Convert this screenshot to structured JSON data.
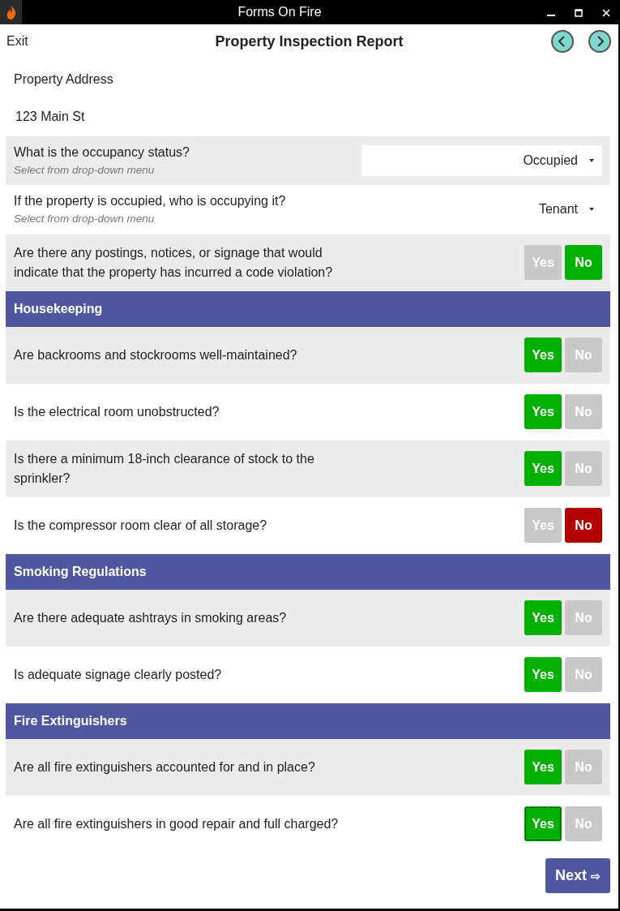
{
  "window": {
    "title": "Forms On Fire"
  },
  "header": {
    "exit": "Exit",
    "title": "Property Inspection Report"
  },
  "address": {
    "label": "Property Address",
    "value": "123 Main St"
  },
  "rows": [
    {
      "kind": "dropdown",
      "question": "What is the occupancy status?",
      "hint": "Select from drop-down menu",
      "value": "Occupied",
      "boxed": true
    },
    {
      "kind": "dropdown",
      "question": "If the property is occupied, who is occupying it?",
      "hint": "Select from drop-down menu",
      "value": "Tenant",
      "boxed": false
    },
    {
      "kind": "yesno",
      "question": "Are there any postings, notices, or signage that would indicate that the property has incurred a code violation?",
      "focused": false,
      "options": [
        {
          "label": "Yes",
          "selected": false,
          "color": "#c8c8c8"
        },
        {
          "label": "No",
          "selected": true,
          "color": "#00b000"
        }
      ]
    },
    {
      "kind": "section",
      "title": "Housekeeping"
    },
    {
      "kind": "yesno",
      "question": "Are backrooms and stockrooms well-maintained?",
      "focused": false,
      "options": [
        {
          "label": "Yes",
          "selected": true,
          "color": "#00b000"
        },
        {
          "label": "No",
          "selected": false,
          "color": "#c8c8c8"
        }
      ]
    },
    {
      "kind": "yesno",
      "question": "Is the electrical room unobstructed?",
      "focused": false,
      "options": [
        {
          "label": "Yes",
          "selected": true,
          "color": "#00b000"
        },
        {
          "label": "No",
          "selected": false,
          "color": "#c8c8c8"
        }
      ]
    },
    {
      "kind": "yesno",
      "question": "Is there a minimum 18-inch clearance of stock to the sprinkler?",
      "focused": false,
      "options": [
        {
          "label": "Yes",
          "selected": true,
          "color": "#00b000"
        },
        {
          "label": "No",
          "selected": false,
          "color": "#c8c8c8"
        }
      ]
    },
    {
      "kind": "yesno",
      "question": "Is the compressor room clear of all storage?",
      "focused": false,
      "options": [
        {
          "label": "Yes",
          "selected": false,
          "color": "#c8c8c8"
        },
        {
          "label": "No",
          "selected": true,
          "color": "#b20000"
        }
      ]
    },
    {
      "kind": "section",
      "title": "Smoking Regulations"
    },
    {
      "kind": "yesno",
      "question": "Are there adequate ashtrays in smoking areas?",
      "focused": false,
      "options": [
        {
          "label": "Yes",
          "selected": true,
          "color": "#00b000"
        },
        {
          "label": "No",
          "selected": false,
          "color": "#c8c8c8"
        }
      ]
    },
    {
      "kind": "yesno",
      "question": "Is adequate signage clearly posted?",
      "focused": false,
      "options": [
        {
          "label": "Yes",
          "selected": true,
          "color": "#00b000"
        },
        {
          "label": "No",
          "selected": false,
          "color": "#c8c8c8"
        }
      ]
    },
    {
      "kind": "section",
      "title": "Fire Extinguishers"
    },
    {
      "kind": "yesno",
      "question": "Are all fire extinguishers accounted for and in place?",
      "focused": false,
      "options": [
        {
          "label": "Yes",
          "selected": true,
          "color": "#00b000"
        },
        {
          "label": "No",
          "selected": false,
          "color": "#c8c8c8"
        }
      ]
    },
    {
      "kind": "yesno",
      "question": "Are all fire extinguishers in good repair and full charged?",
      "focused": true,
      "options": [
        {
          "label": "Yes",
          "selected": true,
          "color": "#00b000"
        },
        {
          "label": "No",
          "selected": false,
          "color": "#c8c8c8"
        }
      ]
    }
  ],
  "next_button": {
    "label": "Next",
    "arrow": "⇨"
  }
}
